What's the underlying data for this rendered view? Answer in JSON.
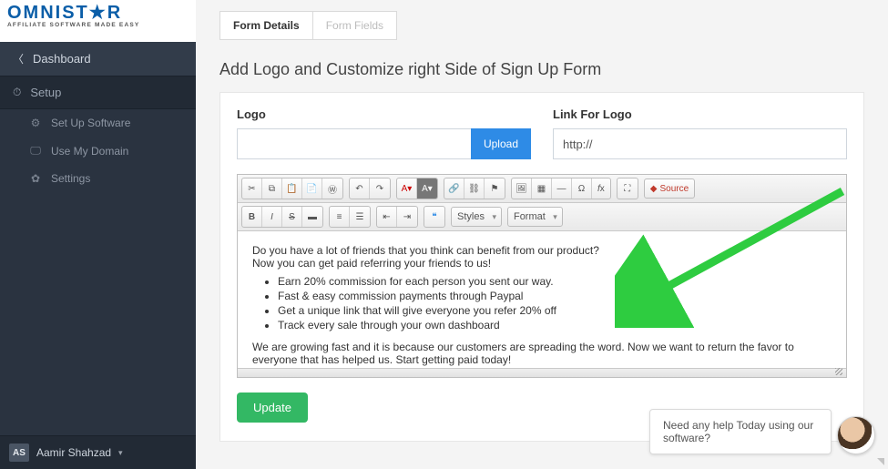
{
  "logo": {
    "line1_a": "OMNI",
    "line1_b": "ST★R",
    "line2": "AFFILIATE SOFTWARE MADE EASY"
  },
  "sidebar": {
    "dashboard": "Dashboard",
    "setup": "Setup",
    "items": [
      {
        "icon": "⚙",
        "label": "Set Up Software"
      },
      {
        "icon": "🖵",
        "label": "Use My Domain"
      },
      {
        "icon": "✿",
        "label": "Settings"
      }
    ],
    "user_initials": "AS",
    "user_name": "Aamir Shahzad"
  },
  "tabs": {
    "active": "Form Details",
    "inactive": "Form Fields"
  },
  "page_title": "Add Logo and Customize right Side of Sign Up Form",
  "form": {
    "logo_label": "Logo",
    "upload_btn": "Upload",
    "link_label": "Link For Logo",
    "link_value": "http://",
    "update_btn": "Update"
  },
  "editor": {
    "styles_label": "Styles",
    "format_label": "Format",
    "source_label": "Source",
    "quote_glyph": "❝",
    "content": {
      "p1": "Do you have a lot of friends that you think can benefit from our product?",
      "p2": "Now you can get paid referring your friends to us!",
      "bullets": [
        "Earn 20% commission for each person you sent our way.",
        "Fast & easy commission payments through Paypal",
        "Get a unique link that will give everyone you refer 20% off",
        "Track every sale through your own dashboard"
      ],
      "p3": "We are growing fast and it is because our customers are spreading the word. Now we want to return the favor to everyone that has helped us. Start getting paid today!"
    }
  },
  "chat": {
    "text": "Need any help Today using our software?"
  }
}
